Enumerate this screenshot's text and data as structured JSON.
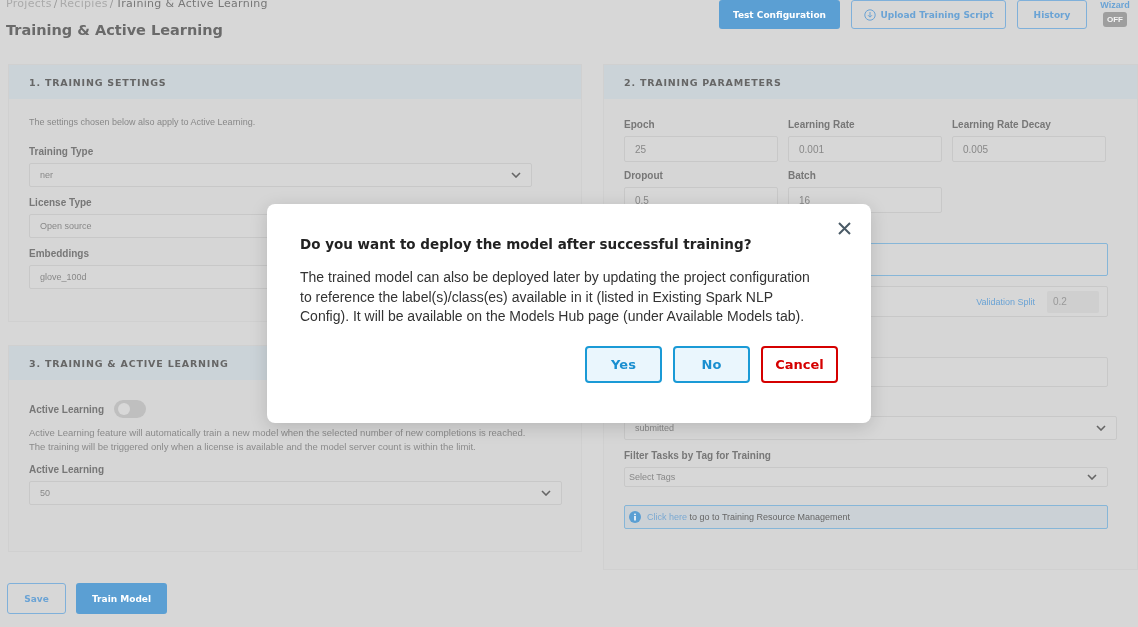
{
  "breadcrumb": {
    "separator": "/",
    "items": [
      {
        "label": "Projects",
        "current": false
      },
      {
        "label": "Recipies",
        "current": false
      },
      {
        "label": "Training & Active Learning",
        "current": true
      }
    ]
  },
  "title": "Training & Active Learning",
  "toolbar": {
    "buttons": [
      {
        "label": "Test Configuration",
        "kind": "primary"
      },
      {
        "label": "Upload Training Script",
        "kind": "upload"
      },
      {
        "label": "History",
        "kind": "outline"
      }
    ],
    "wizard": {
      "label": "Wizard",
      "toggle": "OFF",
      "on": false
    }
  },
  "training_settings": {
    "heading": "1. TRAINING SETTINGS",
    "note": "The settings chosen below also apply to Active Learning.",
    "fields": [
      {
        "label": "Training Type",
        "value": "ner",
        "kind": "dropdown"
      },
      {
        "label": "License Type",
        "value": "Open source",
        "kind": "field"
      },
      {
        "label": "Embeddings",
        "value": "glove_100d",
        "kind": "field"
      }
    ]
  },
  "active_learning": {
    "heading": "3. TRAINING & ACTIVE LEARNING",
    "toggle": {
      "label": "Active Learning",
      "on": false
    },
    "description": [
      "Active Learning feature will automatically train a new model when the selected number of new completions is reached.",
      "The training will be triggered only when a license is available and the model server count is within the limit."
    ],
    "select": {
      "label": "Active Learning",
      "value": "50"
    }
  },
  "footer_buttons": [
    {
      "label": "Save",
      "kind": "outline"
    },
    {
      "label": "Train Model",
      "kind": "primary"
    }
  ],
  "training_parameters": {
    "heading": "2. TRAINING PARAMETERS",
    "rows": [
      [
        {
          "label": "Epoch",
          "value": "25"
        },
        {
          "label": "Learning Rate",
          "value": "0.001"
        },
        {
          "label": "Learning Rate Decay",
          "value": "0.005"
        }
      ],
      [
        {
          "label": "Dropout",
          "value": "0.5"
        },
        {
          "label": "Batch",
          "value": "16"
        }
      ]
    ],
    "focused_field": {
      "focused": true
    },
    "validation_split": {
      "label": "Validation Split",
      "value": "0.2"
    },
    "status_select": {
      "value": "submitted"
    },
    "tag_filter": {
      "label": "Filter Tasks by Tag for Training",
      "placeholder": "Select Tags"
    },
    "info": {
      "link": "Click here",
      "text": "to go to Training Resource Management"
    }
  },
  "dialog": {
    "title": "Do you want to deploy the model after successful training?",
    "body": "The trained model can also be deployed later by updating the project configuration to reference the label(s)/class(es) available in it (listed in Existing Spark NLP Config). It will be available on the Models Hub page (under Available Models tab).",
    "buttons": [
      {
        "label": "Yes",
        "kind": "secondary"
      },
      {
        "label": "No",
        "kind": "secondary"
      },
      {
        "label": "Cancel",
        "kind": "danger"
      }
    ]
  }
}
